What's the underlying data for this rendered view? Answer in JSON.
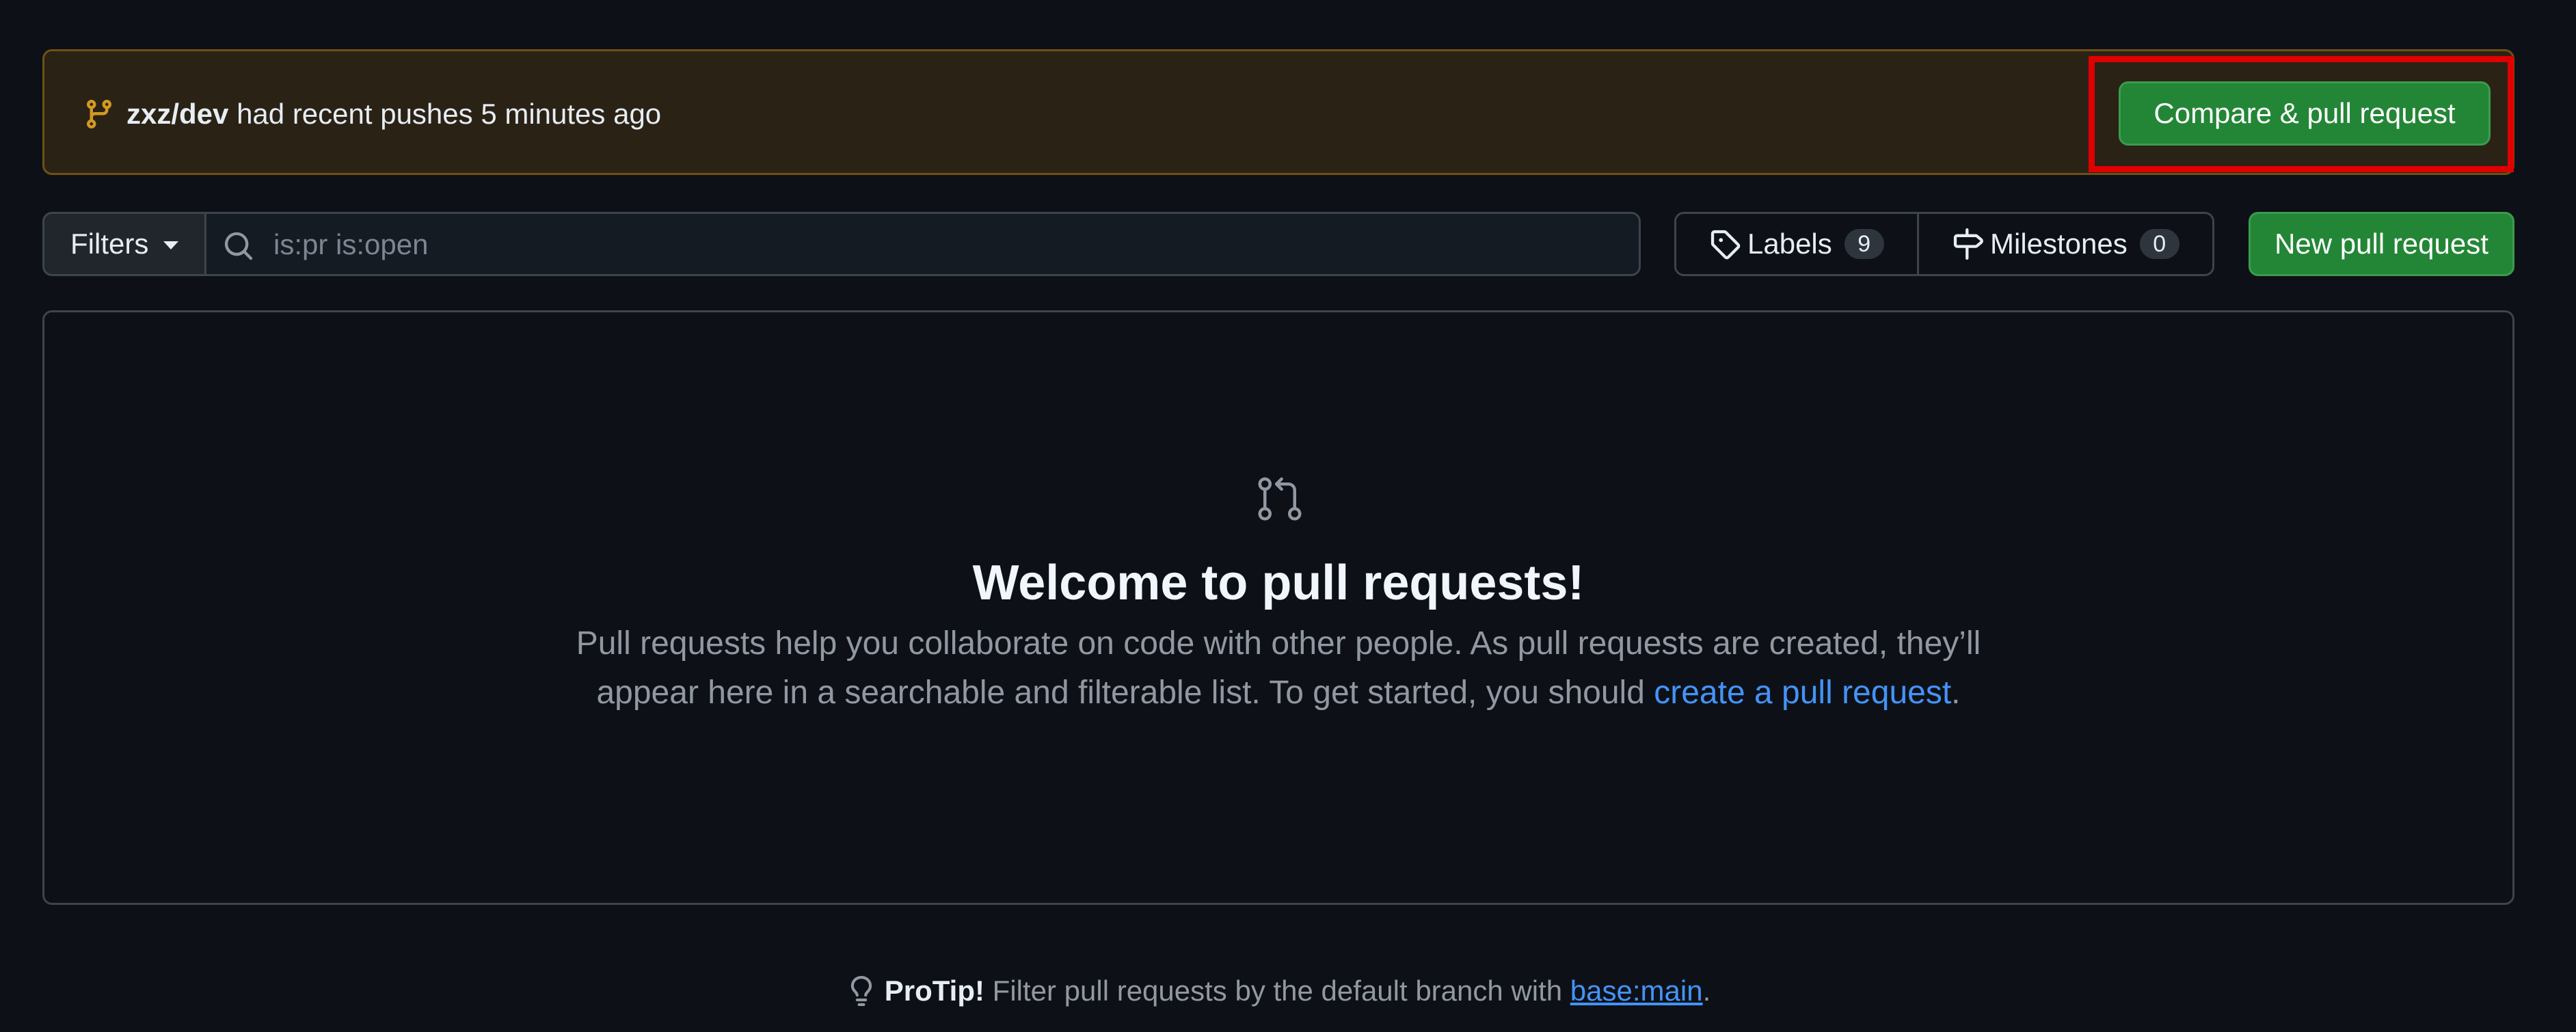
{
  "banner": {
    "branch": "zxz/dev",
    "message": " had recent pushes 5 minutes ago",
    "compare_button": "Compare & pull request",
    "accent_color": "#d29922"
  },
  "toolbar": {
    "filters_label": "Filters",
    "search_placeholder": "is:pr is:open",
    "labels_label": "Labels",
    "labels_count": "9",
    "milestones_label": "Milestones",
    "milestones_count": "0",
    "new_pr_label": "New pull request"
  },
  "blankslate": {
    "icon": "git-pull-request-icon",
    "title": "Welcome to pull requests!",
    "description_before": "Pull requests help you collaborate on code with other people. As pull requests are created, they’ll appear here in a searchable and filterable list. To get started, you should ",
    "description_link": "create a pull request",
    "description_after": "."
  },
  "protip": {
    "icon": "light-bulb-icon",
    "label": "ProTip!",
    "text": " Filter pull requests by the default branch with ",
    "link": "base:main",
    "suffix": "."
  },
  "colors": {
    "background": "#0d1117",
    "primary_button": "#238636",
    "link": "#4493f8",
    "highlight": "#e00000"
  }
}
